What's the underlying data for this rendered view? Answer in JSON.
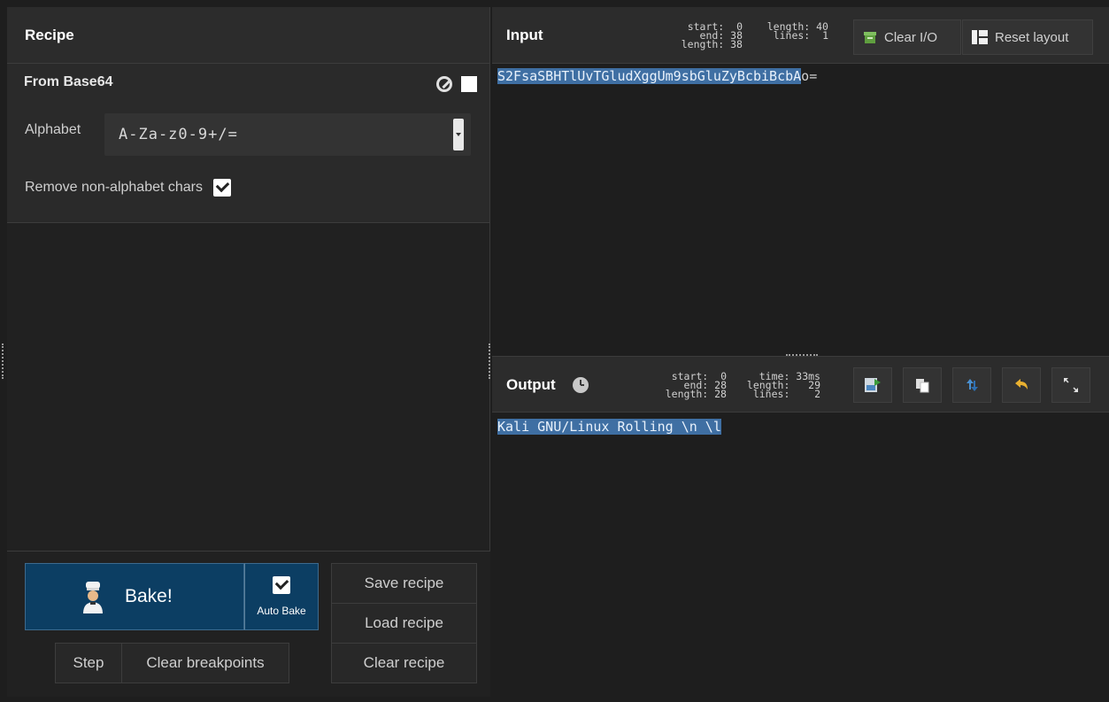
{
  "recipe": {
    "title": "Recipe",
    "operation": {
      "name": "From Base64",
      "alphabet_label": "Alphabet",
      "alphabet_value": "A-Za-z0-9+/=",
      "remove_label": "Remove non-alphabet chars",
      "remove_checked": true
    },
    "controls": {
      "bake_label": "Bake!",
      "auto_bake_label": "Auto Bake",
      "auto_bake_checked": true,
      "step_label": "Step",
      "clear_breakpoints_label": "Clear breakpoints",
      "save_label": "Save recipe",
      "load_label": "Load recipe",
      "clear_label": "Clear recipe"
    }
  },
  "input": {
    "title": "Input",
    "stats_left": "start:  0\nend: 38\nlength: 38",
    "stats_right": "length: 40\nlines:  1",
    "clear_io_label": "Clear I/O",
    "reset_layout_label": "Reset layout",
    "text_selected": "S2FsaSBHTlUvTGludXggUm9sbGluZyBcbiBcbA",
    "text_rest": "o="
  },
  "output": {
    "title": "Output",
    "stats_left": "start:  0\nend: 28\nlength: 28",
    "stats_right": "time: 33ms\nlength:   29\nlines:    2",
    "text_selected": "Kali GNU/Linux Rolling \\n \\l",
    "buttons": [
      "save-to-file-icon",
      "copy-icon",
      "switch-io-icon",
      "undo-icon",
      "maximise-icon"
    ]
  },
  "colors": {
    "bake_bg": "#0c3e63",
    "selection": "#3f6fa3",
    "panel_header": "#2c2c2c"
  }
}
